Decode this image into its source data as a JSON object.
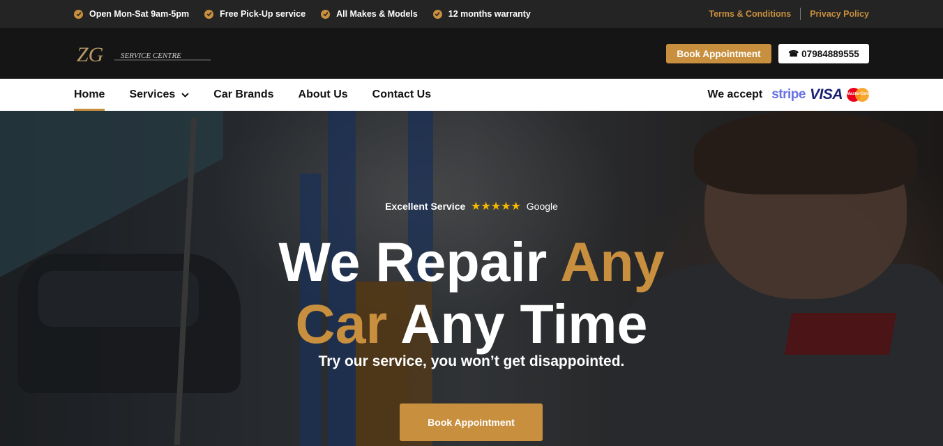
{
  "topbar": {
    "usps": [
      {
        "icon": "check-circle-icon",
        "text": "Open Mon-Sat 9am-5pm"
      },
      {
        "icon": "check-circle-icon",
        "text": "Free Pick-Up service"
      },
      {
        "icon": "check-circle-icon",
        "text": "All Makes & Models"
      },
      {
        "icon": "check-circle-icon",
        "text": "12 months warranty"
      }
    ],
    "links": {
      "terms": "Terms & Conditions",
      "privacy": "Privacy Policy"
    }
  },
  "header": {
    "logo_mark": "ZG",
    "logo_text": "SERVICE CENTRE",
    "book_label": "Book Appointment",
    "phone": "07984889555",
    "phone_icon": "phone-icon"
  },
  "nav": {
    "items": [
      {
        "label": "Home",
        "active": true
      },
      {
        "label": "Services",
        "dropdown": true
      },
      {
        "label": "Car Brands"
      },
      {
        "label": "About Us"
      },
      {
        "label": "Contact Us"
      }
    ],
    "accept_label": "We accept",
    "payments": {
      "stripe": "stripe",
      "visa": "VISA",
      "mastercard": "MasterCard"
    }
  },
  "hero": {
    "rating_label": "Excellent Service",
    "stars": "★★★★★",
    "rating_source": "Google",
    "headline": {
      "w1": "We Repair",
      "w2": "Any",
      "w3": "Car",
      "w4": "Any Time"
    },
    "subtitle": "Try our service, you won’t get disappointed.",
    "cta": "Book Appointment"
  },
  "colors": {
    "accent": "#c88f3e",
    "topbar_bg": "#242424",
    "header_bg": "#151515",
    "nav_bg": "#ffffff"
  }
}
